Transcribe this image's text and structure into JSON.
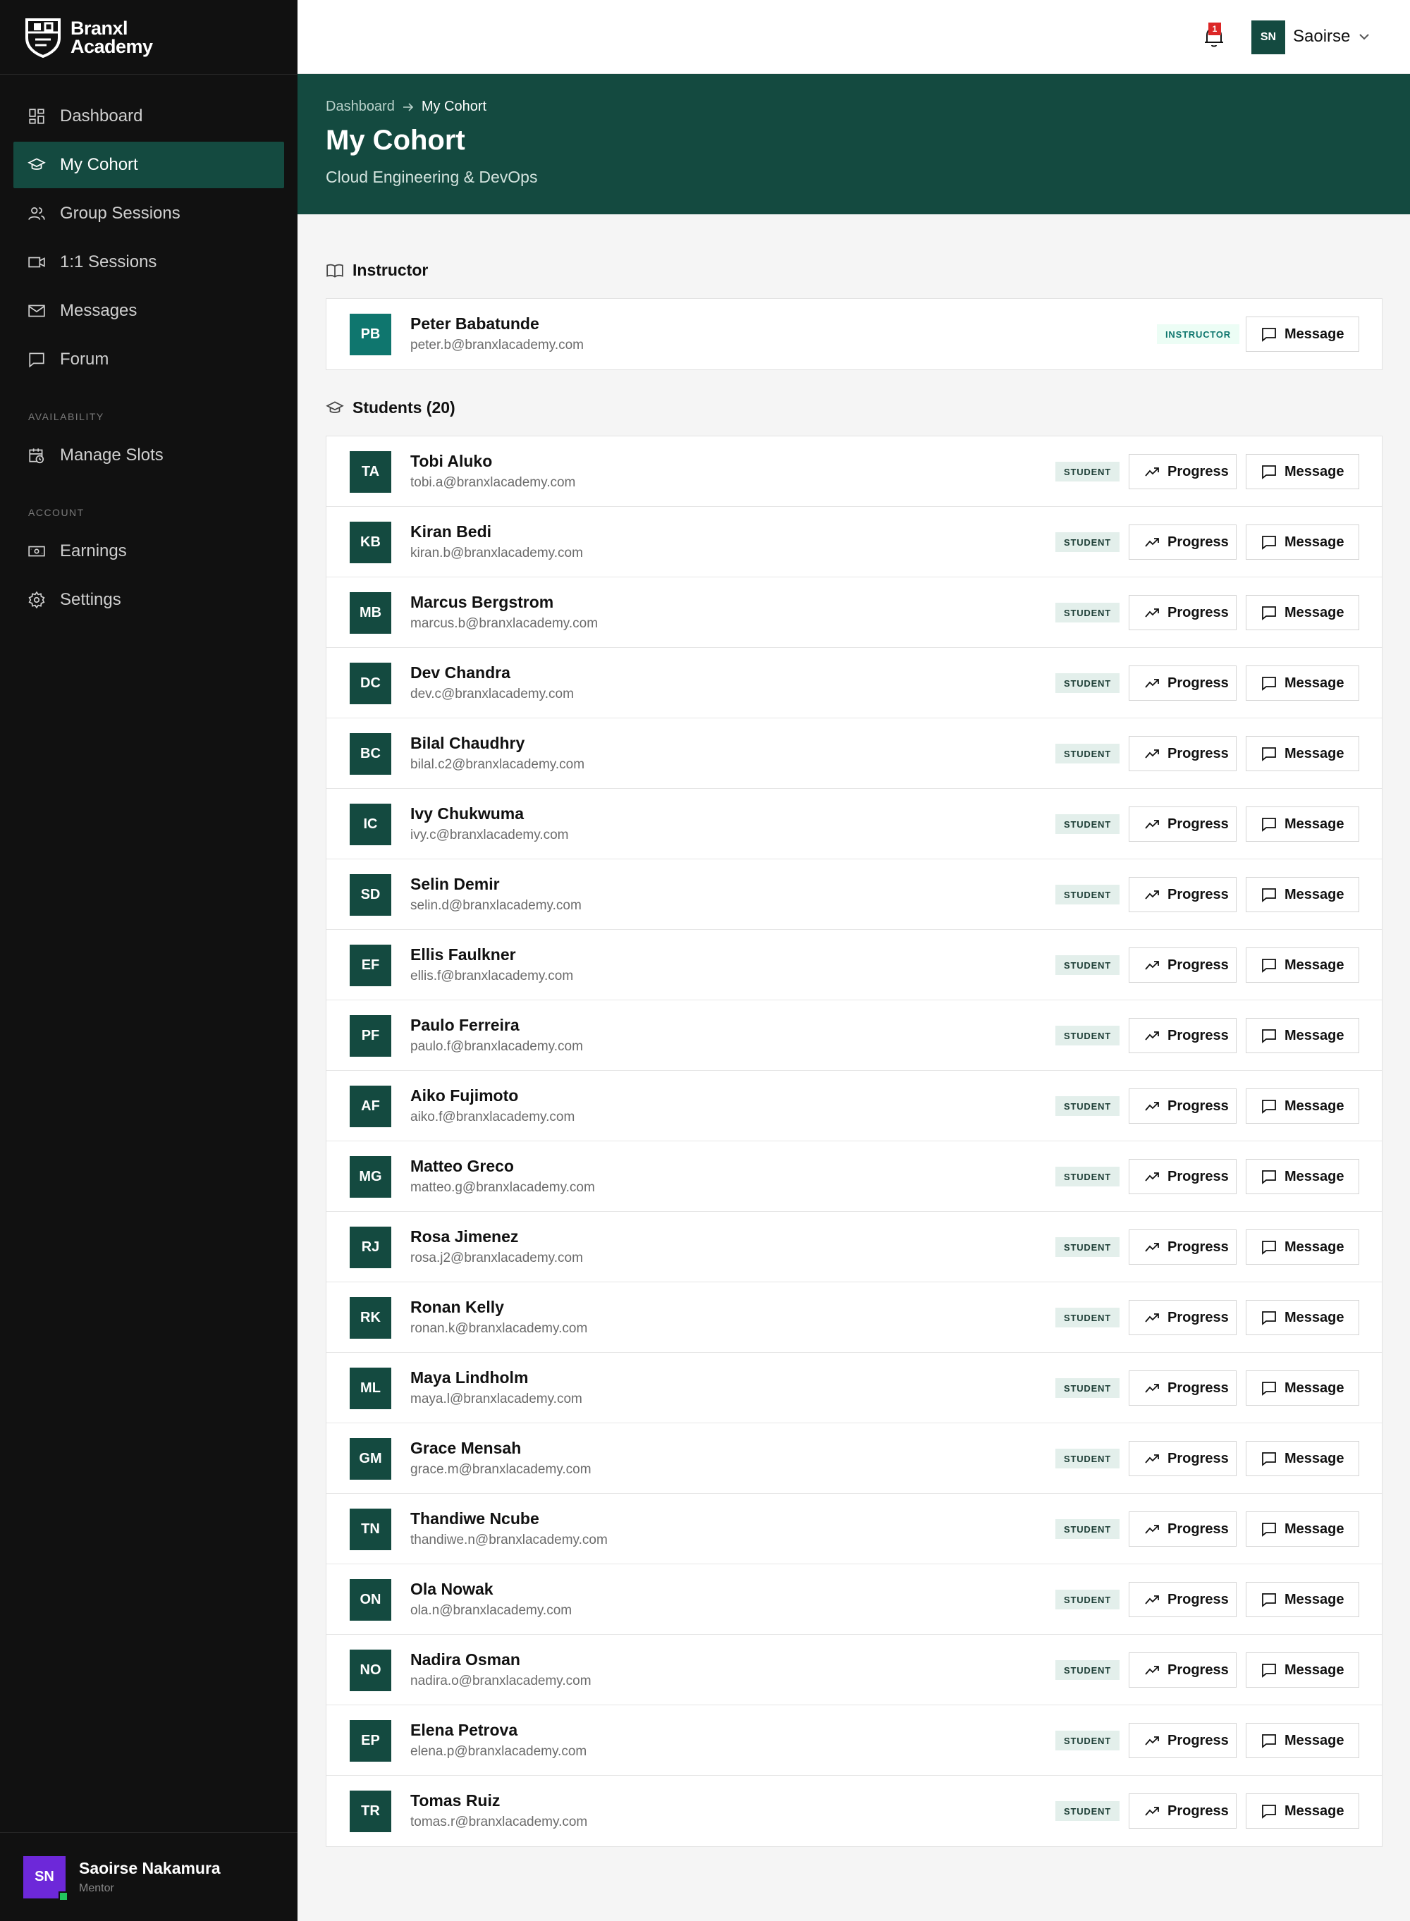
{
  "brand": {
    "line1": "Branxl",
    "line2": "Academy"
  },
  "sidebar": {
    "nav": [
      {
        "label": "Dashboard",
        "icon": "dashboard-icon"
      },
      {
        "label": "My Cohort",
        "icon": "graduation-cap-icon",
        "active": true
      },
      {
        "label": "Group Sessions",
        "icon": "users-icon"
      },
      {
        "label": "1:1 Sessions",
        "icon": "video-icon"
      },
      {
        "label": "Messages",
        "icon": "mail-icon"
      },
      {
        "label": "Forum",
        "icon": "chat-icon"
      }
    ],
    "availability_label": "AVAILABILITY",
    "availability": [
      {
        "label": "Manage Slots",
        "icon": "calendar-clock-icon"
      }
    ],
    "account_label": "ACCOUNT",
    "account": [
      {
        "label": "Earnings",
        "icon": "cash-icon"
      },
      {
        "label": "Settings",
        "icon": "gear-icon"
      }
    ],
    "user": {
      "initials": "SN",
      "name": "Saoirse Nakamura",
      "role": "Mentor"
    }
  },
  "topbar": {
    "notification_count": "1",
    "user_initials": "SN",
    "user_name": "Saoirse"
  },
  "header": {
    "breadcrumb_root": "Dashboard",
    "breadcrumb_current": "My Cohort",
    "title": "My Cohort",
    "subtitle": "Cloud Engineering & DevOps"
  },
  "instructor_section": {
    "title": "Instructor",
    "person": {
      "initials": "PB",
      "name": "Peter Babatunde",
      "email": "peter.b@branxlacademy.com",
      "role": "INSTRUCTOR"
    }
  },
  "students_section": {
    "title": "Students (20)",
    "students": [
      {
        "initials": "TA",
        "name": "Tobi Aluko",
        "email": "tobi.a@branxlacademy.com"
      },
      {
        "initials": "KB",
        "name": "Kiran Bedi",
        "email": "kiran.b@branxlacademy.com"
      },
      {
        "initials": "MB",
        "name": "Marcus Bergstrom",
        "email": "marcus.b@branxlacademy.com"
      },
      {
        "initials": "DC",
        "name": "Dev Chandra",
        "email": "dev.c@branxlacademy.com"
      },
      {
        "initials": "BC",
        "name": "Bilal Chaudhry",
        "email": "bilal.c2@branxlacademy.com"
      },
      {
        "initials": "IC",
        "name": "Ivy Chukwuma",
        "email": "ivy.c@branxlacademy.com"
      },
      {
        "initials": "SD",
        "name": "Selin Demir",
        "email": "selin.d@branxlacademy.com"
      },
      {
        "initials": "EF",
        "name": "Ellis Faulkner",
        "email": "ellis.f@branxlacademy.com"
      },
      {
        "initials": "PF",
        "name": "Paulo Ferreira",
        "email": "paulo.f@branxlacademy.com"
      },
      {
        "initials": "AF",
        "name": "Aiko Fujimoto",
        "email": "aiko.f@branxlacademy.com"
      },
      {
        "initials": "MG",
        "name": "Matteo Greco",
        "email": "matteo.g@branxlacademy.com"
      },
      {
        "initials": "RJ",
        "name": "Rosa Jimenez",
        "email": "rosa.j2@branxlacademy.com"
      },
      {
        "initials": "RK",
        "name": "Ronan Kelly",
        "email": "ronan.k@branxlacademy.com"
      },
      {
        "initials": "ML",
        "name": "Maya Lindholm",
        "email": "maya.l@branxlacademy.com"
      },
      {
        "initials": "GM",
        "name": "Grace Mensah",
        "email": "grace.m@branxlacademy.com"
      },
      {
        "initials": "TN",
        "name": "Thandiwe Ncube",
        "email": "thandiwe.n@branxlacademy.com"
      },
      {
        "initials": "ON",
        "name": "Ola Nowak",
        "email": "ola.n@branxlacademy.com"
      },
      {
        "initials": "NO",
        "name": "Nadira Osman",
        "email": "nadira.o@branxlacademy.com"
      },
      {
        "initials": "EP",
        "name": "Elena Petrova",
        "email": "elena.p@branxlacademy.com"
      },
      {
        "initials": "TR",
        "name": "Tomas Ruiz",
        "email": "tomas.r@branxlacademy.com"
      }
    ]
  },
  "labels": {
    "student_role": "STUDENT",
    "progress_button": "Progress",
    "message_button": "Message"
  },
  "colors": {
    "brand_green": "#144a40",
    "sidebar_bg": "#111111",
    "avatar_purple": "#6d28d9",
    "badge_red": "#dc2626"
  }
}
